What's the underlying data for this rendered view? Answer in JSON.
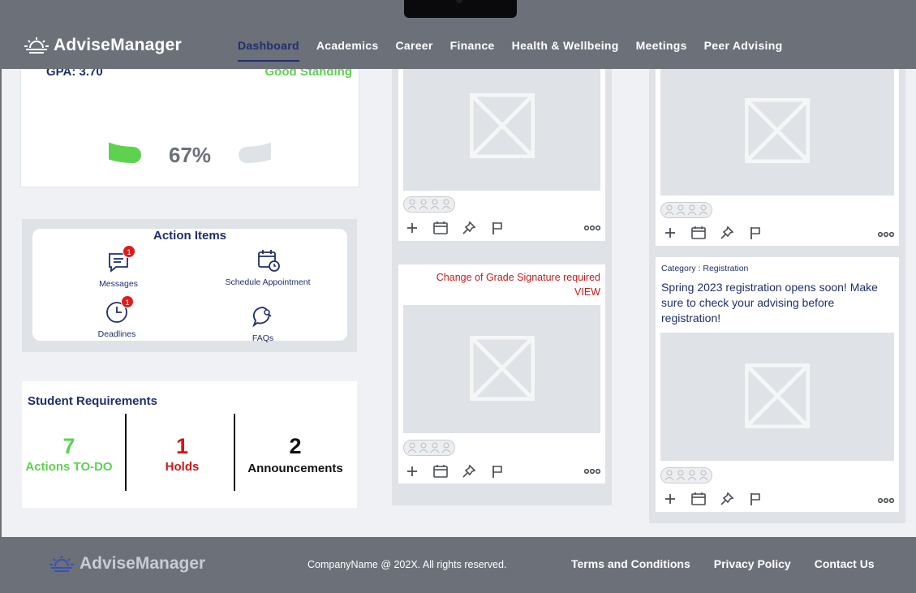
{
  "app": {
    "logo_text": "AdviseManager"
  },
  "nav": {
    "items": [
      {
        "label": "Dashboard",
        "active": true
      },
      {
        "label": "Academics"
      },
      {
        "label": "Career"
      },
      {
        "label": "Finance"
      },
      {
        "label": "Health & Wellbeing"
      },
      {
        "label": "Meetings"
      },
      {
        "label": "Peer Advising"
      }
    ]
  },
  "gpa": {
    "gpa_label": "GPA: 3.70",
    "standing_label": "Good Standing",
    "progress_label": "67%",
    "progress_value": 0.67,
    "colors": {
      "fill": "#5dd24f",
      "track": "#dfe2e6"
    }
  },
  "action_items": {
    "title": "Action Items",
    "items": [
      {
        "label": "Messages",
        "badge": "1",
        "icon": "message-icon"
      },
      {
        "label": "Schedule Appointment",
        "icon": "calendar-clock-icon"
      },
      {
        "label": "Deadlines",
        "badge": "1",
        "icon": "clock-icon"
      },
      {
        "label": "FAQs",
        "icon": "faq-search-icon"
      }
    ]
  },
  "requirements": {
    "title": "Student Requirements",
    "stats": [
      {
        "value": "7",
        "label": "Actions TO-DO",
        "color": "#5dd24f"
      },
      {
        "value": "1",
        "label": "Holds",
        "color": "#d11717"
      },
      {
        "value": "2",
        "label": "Announcements",
        "color": "#111111"
      }
    ]
  },
  "posts": {
    "middle_second": {
      "alert": "Change of Grade Signature required",
      "link": "VIEW"
    },
    "right_second": {
      "category": "Category : Registration",
      "title": "Spring 2023 registration opens soon! Make sure to check your advising before registration!"
    }
  },
  "footer": {
    "logo_text": "AdviseManager",
    "copyright": "CompanyName @ 202X. All rights reserved.",
    "links": [
      "Terms and Conditions",
      "Privacy Policy",
      "Contact Us"
    ]
  },
  "colors": {
    "brand_navy": "#1f2e6e",
    "header_gray": "#6b7079",
    "success_green": "#5dd24f",
    "alert_red": "#d11717"
  }
}
